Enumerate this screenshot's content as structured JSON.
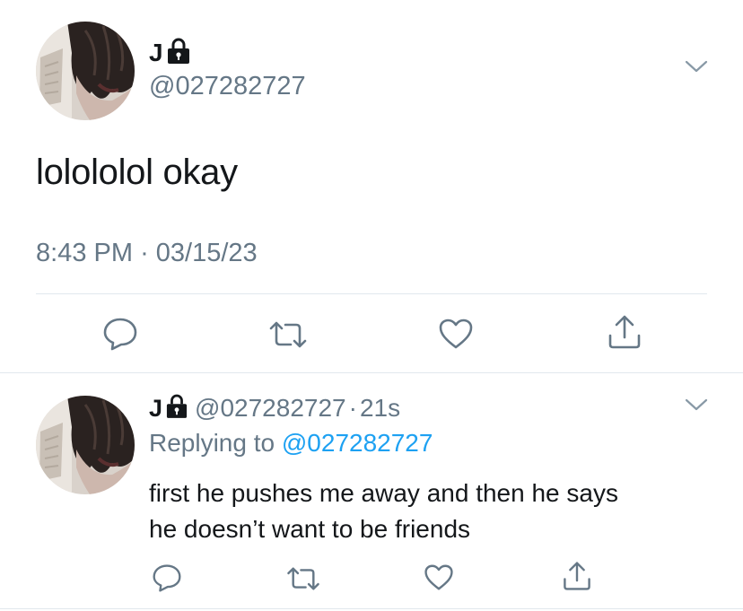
{
  "main_tweet": {
    "display_name": "J",
    "handle": "@027282727",
    "text": "lolololol okay",
    "time": "8:43 PM",
    "separator": "·",
    "date": "03/15/23",
    "protected_icon": "lock-icon",
    "actions": [
      "reply-icon",
      "retweet-icon",
      "like-icon",
      "share-icon"
    ]
  },
  "reply_tweet": {
    "display_name": "J",
    "handle": "@027282727",
    "separator": "·",
    "time": "21s",
    "replying_label": "Replying to",
    "replying_handle": "@027282727",
    "text_lines": [
      "first he pushes me away and then he says",
      "he doesn’t want to be friends"
    ],
    "protected_icon": "lock-icon",
    "actions": [
      "reply-icon",
      "retweet-icon",
      "like-icon",
      "share-icon"
    ]
  },
  "colors": {
    "text": "#14171a",
    "secondary": "#657786",
    "link": "#1da1f2",
    "divider": "#e1e8ed"
  }
}
